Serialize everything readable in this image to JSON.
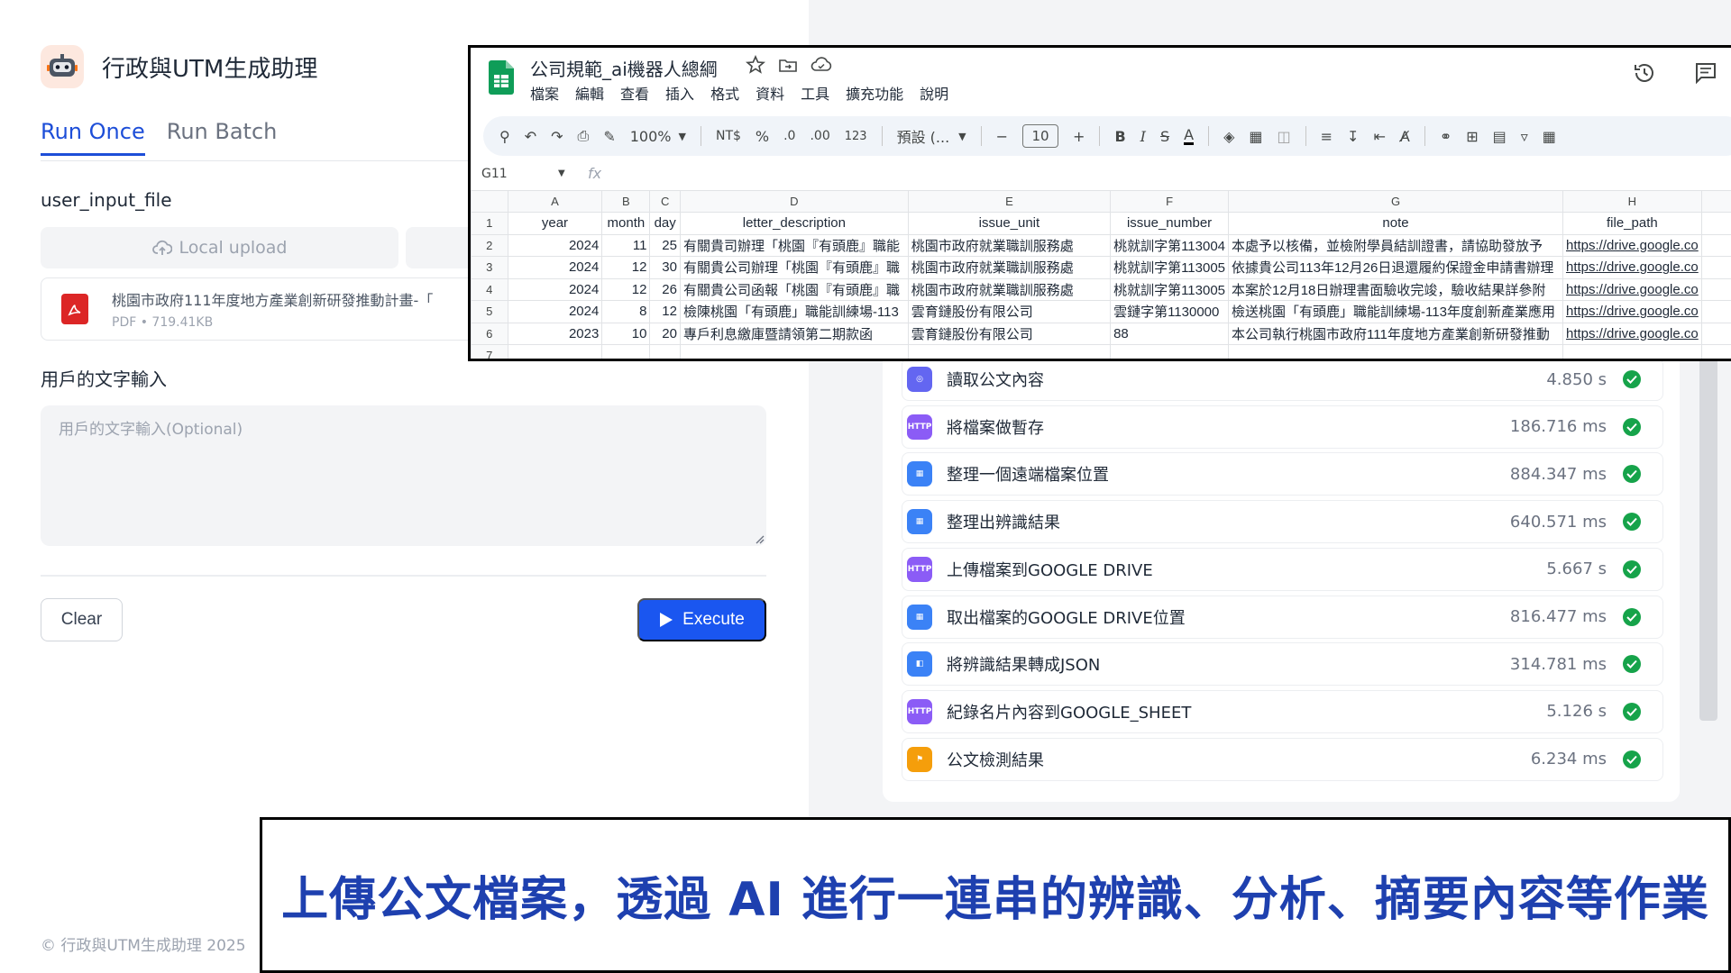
{
  "app": {
    "title": "行政與UTM生成助理",
    "logo_icon": "robot-icon",
    "tabs": [
      {
        "label": "Run Once",
        "active": true
      },
      {
        "label": "Run Batch",
        "active": false
      }
    ],
    "file_field_label": "user_input_file",
    "upload_button_label": "Local upload",
    "file": {
      "name": "桃園市政府111年度地方產業創新研發推動計畫-「",
      "meta": "PDF • 719.41KB"
    },
    "text_field_label": "用戶的文字輸入",
    "text_field_placeholder": "用戶的文字輸入(Optional)",
    "clear_label": "Clear",
    "execute_label": "Execute",
    "footer": "© 行政與UTM生成助理 2025",
    "accent_color": "#1a56f0"
  },
  "workflow": {
    "steps": [
      {
        "label": "讀取公文內容",
        "time": "4.850 s",
        "icon": "llm-icon",
        "color": "#6366f1"
      },
      {
        "label": "將檔案做暫存",
        "time": "186.716 ms",
        "icon": "http-icon",
        "color": "#8b5cf6"
      },
      {
        "label": "整理一個遠端檔案位置",
        "time": "884.347 ms",
        "icon": "code-icon",
        "color": "#3b82f6"
      },
      {
        "label": "整理出辨識結果",
        "time": "640.571 ms",
        "icon": "code-icon",
        "color": "#3b82f6"
      },
      {
        "label": "上傳檔案到GOOGLE DRIVE",
        "time": "5.667 s",
        "icon": "http-icon",
        "color": "#8b5cf6"
      },
      {
        "label": "取出檔案的GOOGLE DRIVE位置",
        "time": "816.477 ms",
        "icon": "code-icon",
        "color": "#3b82f6"
      },
      {
        "label": "將辨識結果轉成JSON",
        "time": "314.781 ms",
        "icon": "document-icon",
        "color": "#3b82f6"
      },
      {
        "label": "紀錄名片內容到GOOGLE_SHEET",
        "time": "5.126 s",
        "icon": "http-icon",
        "color": "#8b5cf6"
      },
      {
        "label": "公文檢測結果",
        "time": "6.234 ms",
        "icon": "end-icon",
        "color": "#f59e0b"
      }
    ],
    "success_color": "#16a34a"
  },
  "sheet": {
    "title": "公司規範_ai機器人總綱",
    "menu": [
      "檔案",
      "編輯",
      "查看",
      "插入",
      "格式",
      "資料",
      "工具",
      "擴充功能",
      "說明"
    ],
    "toolbar": {
      "zoom": "100%",
      "currency": "NT$",
      "percent": "%",
      "dec_less": ".0",
      "dec_more": ".00",
      "number_format": "123",
      "font": "預設 (...",
      "font_size": "10"
    },
    "name_box": "G11",
    "fx": "fx",
    "columns": [
      "A",
      "B",
      "C",
      "D",
      "E",
      "F",
      "G",
      "H"
    ],
    "headers": [
      "year",
      "month",
      "day",
      "letter_description",
      "issue_unit",
      "issue_number",
      "note",
      "file_path"
    ],
    "rows": [
      [
        "2024",
        "11",
        "25",
        "有關貴司辦理「桃園『有頭鹿』職能",
        "桃園市政府就業職訓服務處",
        "桃就訓字第113004",
        "本處予以核備，並檢附學員結訓證書，請協助發放予",
        "https://drive.google.co"
      ],
      [
        "2024",
        "12",
        "30",
        "有關貴公司辦理「桃園『有頭鹿』職",
        "桃園市政府就業職訓服務處",
        "桃就訓字第113005",
        "依據貴公司113年12月26日退還履約保證金申請書辦理",
        "https://drive.google.co"
      ],
      [
        "2024",
        "12",
        "26",
        "有關貴公司函報「桃園『有頭鹿』職",
        "桃園市政府就業職訓服務處",
        "桃就訓字第113005",
        "本案於12月18日辦理書面驗收完竣，驗收結果詳參附",
        "https://drive.google.co"
      ],
      [
        "2024",
        "8",
        "12",
        "檢陳桃園「有頭鹿」職能訓練場-113",
        "雲育鏈股份有限公司",
        "雲鏈字第1130000",
        "檢送桃園「有頭鹿」職能訓練場-113年度創新產業應用",
        "https://drive.google.co"
      ],
      [
        "2023",
        "10",
        "20",
        "專戶利息繳庫暨請領第二期款函",
        "雲育鏈股份有限公司",
        "88",
        "本公司執行桃園市政府111年度地方產業創新研發推動",
        "https://drive.google.co"
      ]
    ]
  },
  "caption": "上傳公文檔案，透過 AI 進行一連串的辨識、分析、摘要內容等作業"
}
